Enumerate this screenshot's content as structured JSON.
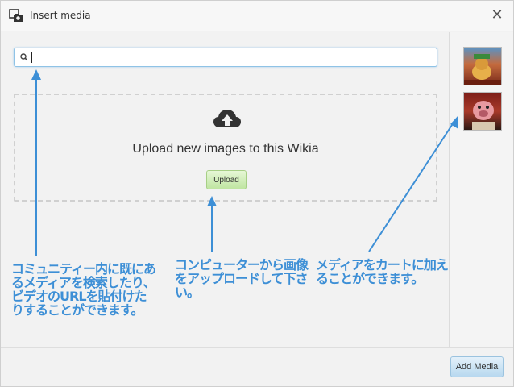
{
  "window": {
    "title": "Insert media"
  },
  "search": {
    "value": "",
    "placeholder": ""
  },
  "upload": {
    "heading": "Upload new images to this Wikia",
    "button_label": "Upload"
  },
  "footer": {
    "add_media_label": "Add Media"
  },
  "annotations": {
    "search_note": "コミュニティー内に既にあるメディアを検索したり、ビデオのURLを貼付けたりすることができます。",
    "upload_note": "コンピューターから画像をアップロードして下さい。",
    "cart_note": "メディアをカートに加えることができます。"
  },
  "colors": {
    "annotation": "#3d8fd6",
    "upload_button": "#c8eab0",
    "add_media_button": "#c5e1f4"
  },
  "icons": {
    "title": "insert-media-icon",
    "close": "close-icon",
    "search": "search-icon",
    "upload": "cloud-upload-icon"
  }
}
